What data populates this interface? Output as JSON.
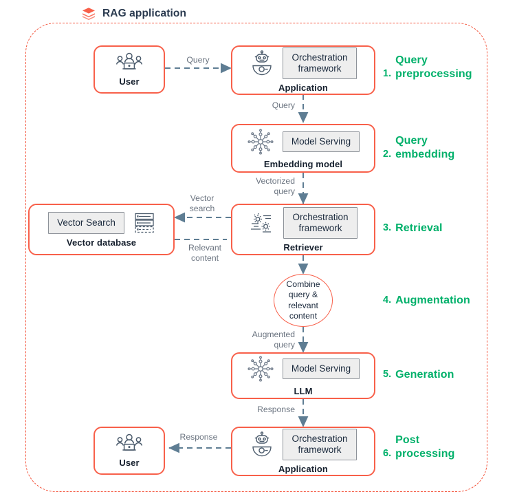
{
  "diagram": {
    "title": "RAG application",
    "title_icon": "layers-icon",
    "accent_border": "#f8604a",
    "container_border": "#f4553d",
    "step_color": "#00b06a",
    "chip_fill": "#eeeeee",
    "chip_border": "#8d9299",
    "arrow_color": "#5e7d93",
    "text_color": "#1b2a3d",
    "edge_label_color": "#6b7480"
  },
  "nodes": [
    {
      "id": "user-top",
      "label": "User",
      "icon": "users-laptop-icon",
      "chip": null
    },
    {
      "id": "application-top",
      "label": "Application",
      "icon": "robot-icon",
      "chip": "Orchestration\nframework"
    },
    {
      "id": "embedding-model",
      "label": "Embedding model",
      "icon": "neural-network-icon",
      "chip": "Model Serving"
    },
    {
      "id": "vector-database",
      "label": "Vector database",
      "icon": "database-stack-icon",
      "chip": "Vector Search"
    },
    {
      "id": "retriever",
      "label": "Retriever",
      "icon": "gears-icon",
      "chip": "Orchestration\nframework"
    },
    {
      "id": "augmentation-circle",
      "label": "Combine\nquery &\nrelevant\ncontent",
      "icon": null,
      "chip": null
    },
    {
      "id": "llm",
      "label": "LLM",
      "icon": "neural-network-icon",
      "chip": "Model Serving"
    },
    {
      "id": "application-bottom",
      "label": "Application",
      "icon": "robot-icon",
      "chip": "Orchestration\nframework"
    },
    {
      "id": "user-bottom",
      "label": "User",
      "icon": "users-laptop-icon",
      "chip": null
    }
  ],
  "steps": [
    {
      "num": "1.",
      "text": "Query\npreprocessing"
    },
    {
      "num": "2.",
      "text": "Query\nembedding"
    },
    {
      "num": "3.",
      "text": "Retrieval"
    },
    {
      "num": "4.",
      "text": "Augmentation"
    },
    {
      "num": "5.",
      "text": "Generation"
    },
    {
      "num": "6.",
      "text": "Post\nprocessing"
    }
  ],
  "edges": [
    {
      "id": "user-to-app",
      "label": "Query"
    },
    {
      "id": "app-to-embedding",
      "label": "Query"
    },
    {
      "id": "embedding-to-retriever",
      "label": "Vectorized\nquery"
    },
    {
      "id": "retriever-to-vectordb",
      "label": "Vector\nsearch"
    },
    {
      "id": "vectordb-to-retriever",
      "label": "Relevant\ncontent"
    },
    {
      "id": "retriever-to-augmentation",
      "label": ""
    },
    {
      "id": "augmentation-to-llm",
      "label": "Augmented\nquery"
    },
    {
      "id": "llm-to-application",
      "label": "Response"
    },
    {
      "id": "application-to-user",
      "label": "Response"
    }
  ]
}
